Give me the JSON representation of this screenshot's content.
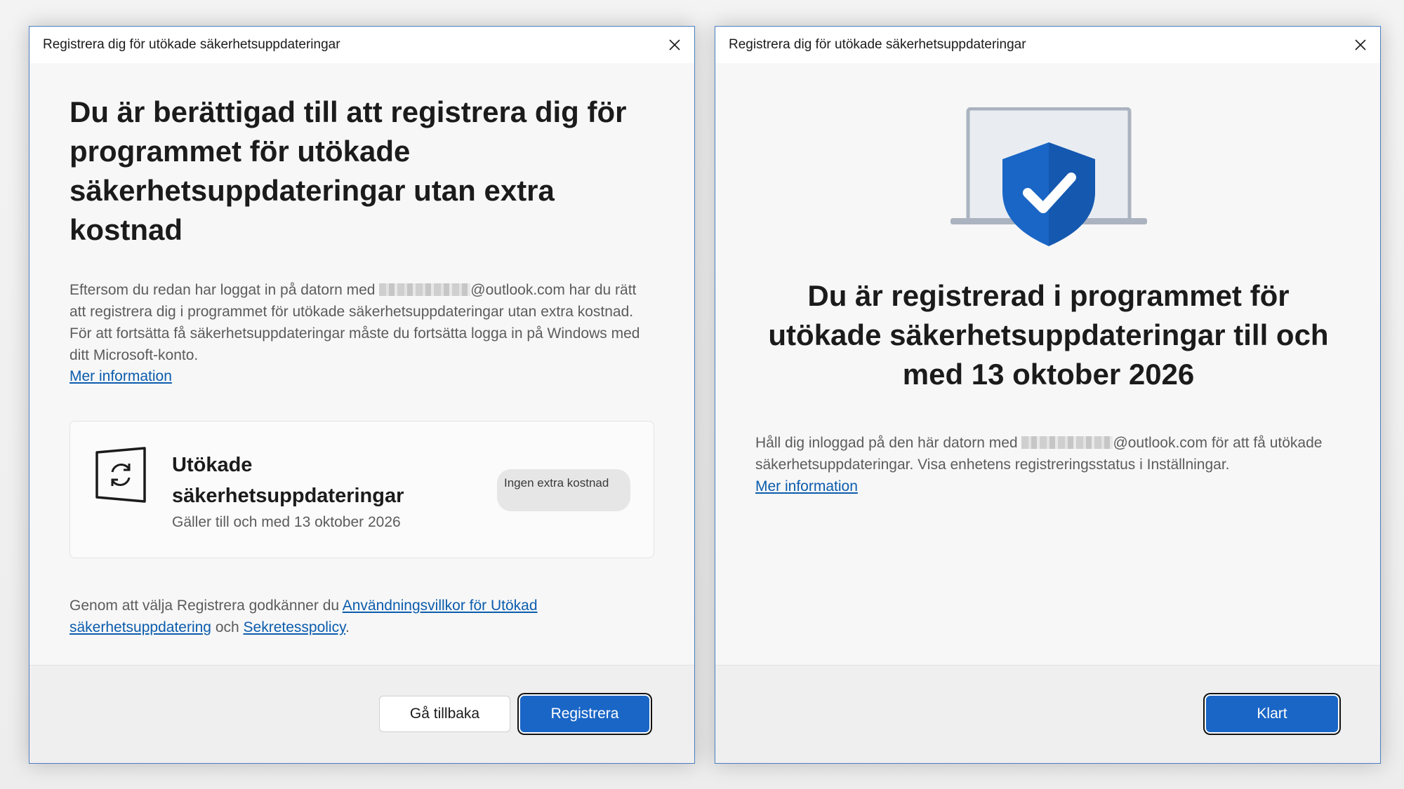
{
  "left_dialog": {
    "title": "Registrera dig för utökade säkerhetsuppdateringar",
    "heading": "Du är berättigad till att registrera dig för programmet för utökade säkerhetsuppdateringar utan extra kostnad",
    "body_before_email": "Eftersom du redan har loggat in på datorn med ",
    "email_domain": "@outlook.com",
    "body_after_email": " har du rätt att registrera dig i programmet för utökade säkerhetsuppdateringar utan extra kostnad. För att fortsätta få säkerhetsuppdateringar måste du fortsätta logga in på Windows med ditt Microsoft-konto.",
    "more_info_link": "Mer information",
    "card": {
      "title": "Utökade säkerhetsuppdateringar",
      "subtitle": "Gäller till och med 13 oktober 2026",
      "badge": "Ingen extra kostnad",
      "icon": "sync-window-icon"
    },
    "terms_prefix": "Genom att välja Registrera godkänner du ",
    "terms_link": "Användningsvillkor för Utökad säkerhetsuppdatering",
    "terms_middle": " och ",
    "privacy_link": "Sekretesspolicy",
    "terms_suffix": ".",
    "back_button": "Gå tillbaka",
    "register_button": "Registrera"
  },
  "right_dialog": {
    "title": "Registrera dig för utökade säkerhetsuppdateringar",
    "illustration": "laptop-shield-check-icon",
    "heading": "Du är registrerad i programmet för utökade säkerhetsuppdateringar till och med 13 oktober 2026",
    "body_before_email": "Håll dig inloggad på den här datorn med ",
    "email_domain": "@outlook.com",
    "body_after_email": " för att få utökade säkerhetsuppdateringar. Visa enhetens registreringsstatus i Inställningar.",
    "more_info_link": "Mer information",
    "done_button": "Klart"
  },
  "colors": {
    "accent": "#1a66c6",
    "link": "#0b5cad",
    "shield": "#1a66c6",
    "dialog_border": "#4a7ec0"
  }
}
